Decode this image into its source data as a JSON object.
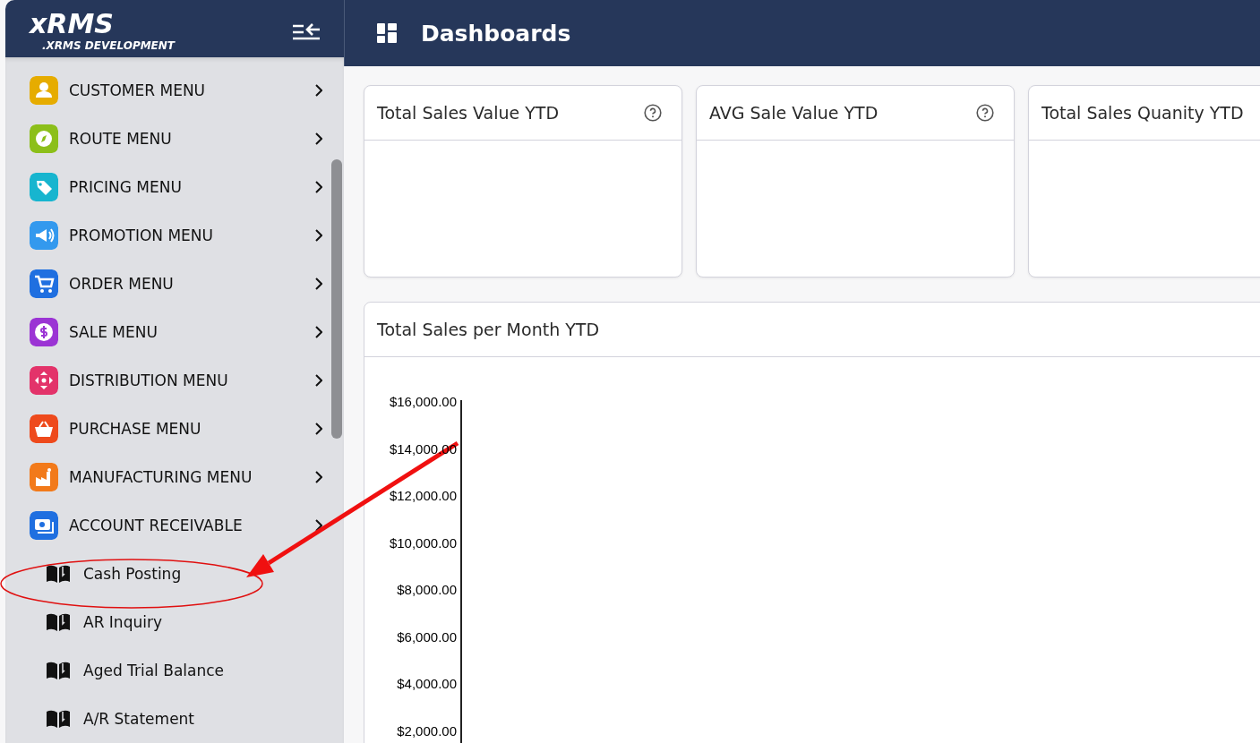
{
  "sidebar": {
    "logo": "xRMS",
    "subtitle": ".XRMS DEVELOPMENT",
    "items": [
      {
        "label": "CUSTOMER MENU",
        "color": "#e6ac00"
      },
      {
        "label": "ROUTE MENU",
        "color": "#8cbf1a"
      },
      {
        "label": "PRICING MENU",
        "color": "#17b5cf"
      },
      {
        "label": "PROMOTION MENU",
        "color": "#3399ee"
      },
      {
        "label": "ORDER MENU",
        "color": "#1f6fe0"
      },
      {
        "label": "SALE MENU",
        "color": "#9b34d4"
      },
      {
        "label": "DISTRIBUTION MENU",
        "color": "#e3336a"
      },
      {
        "label": "PURCHASE MENU",
        "color": "#ee4a1c"
      },
      {
        "label": "MANUFACTURING MENU",
        "color": "#f27a1a"
      },
      {
        "label": "ACCOUNT RECEIVABLE",
        "color": "#1f6fe0",
        "children": [
          {
            "label": "Cash Posting"
          },
          {
            "label": "AR Inquiry"
          },
          {
            "label": "Aged Trial Balance"
          },
          {
            "label": "A/R Statement"
          }
        ]
      }
    ]
  },
  "topbar": {
    "title": "Dashboards"
  },
  "cards": [
    {
      "title": "Total Sales Value YTD",
      "help": true
    },
    {
      "title": "AVG Sale Value YTD",
      "help": true
    },
    {
      "title": "Total Sales Quanity YTD",
      "help": false
    }
  ],
  "chart_card": {
    "title": "Total Sales per Month YTD",
    "axis_labels": [
      "$16,000.00",
      "$14,000.00",
      "$12,000.00",
      "$10,000.00",
      "$8,000.00",
      "$6,000.00",
      "$4,000.00",
      "$2,000.00"
    ]
  },
  "markup": [
    {
      "kind": "ellipse"
    },
    {
      "kind": "arrow"
    }
  ]
}
